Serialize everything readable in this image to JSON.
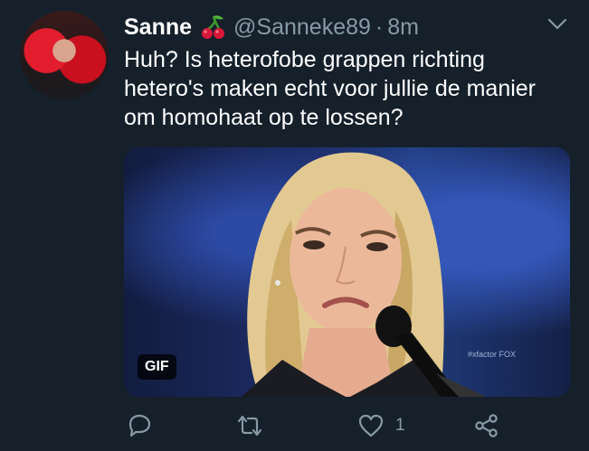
{
  "tweet": {
    "name": "Sanne",
    "handle": "@Sanneke89",
    "separator": "·",
    "time": "8m",
    "text_lines": [
      "Huh? Is heterofobe grappen richting",
      "hetero's maken echt voor jullie de manier",
      "om homohaat op te lossen?"
    ],
    "media": {
      "badge": "GIF",
      "watermark": "#xfactor FOX"
    },
    "actions": {
      "reply_icon": "reply-icon",
      "retweet_icon": "retweet-icon",
      "like_icon": "heart-icon",
      "like_count": "1",
      "share_icon": "share-icon"
    }
  },
  "colors": {
    "background": "#15202b",
    "secondary_text": "#8899a6",
    "primary_text": "#ffffff"
  }
}
